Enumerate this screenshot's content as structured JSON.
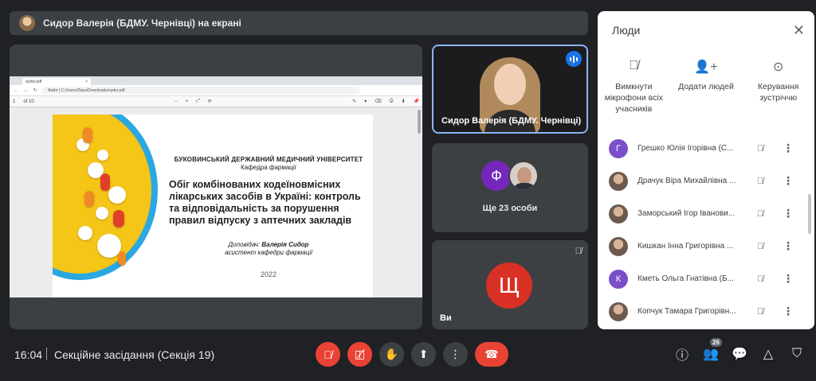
{
  "presenter_bar": {
    "title": "Сидор Валерія (БДМУ. Чернівці) на екрані"
  },
  "shared_screen": {
    "browser_tab_title": "sydor.pdf",
    "address": "Файл | C:/Users/Лера/Downloads/sydor.pdf",
    "pdf_page": "1",
    "pdf_page_total": "of 10",
    "pdf_zoom_minus": "−",
    "pdf_zoom_plus": "+",
    "slide": {
      "university": "БУКОВИНСЬКИЙ ДЕРЖАВНИЙ МЕДИЧНИЙ УНІВЕРСИТЕТ",
      "department": "Кафедра фармації",
      "title": "Обіг комбінованих кодеїновмісних лікарських засобів в Україні: контроль та відповідальність за порушення правил відпуску з аптечних закладів",
      "speaker_prefix": "Доповідач:",
      "speaker_name": "Валерія Сидор",
      "speaker_position": "асистент кафедри фармації",
      "year": "2022"
    }
  },
  "tiles": {
    "presenter_name": "Сидор Валерія (БДМУ. Чернівці)",
    "more_initial": "Ф",
    "more_label": "Ще 23 особи",
    "you_initial": "Щ",
    "you_label": "Ви"
  },
  "people_panel": {
    "title": "Люди",
    "actions": [
      {
        "label": "Вимкнути мікрофони всіх учасників",
        "icon": "mic-off-icon"
      },
      {
        "label": "Додати людей",
        "icon": "person-add-icon"
      },
      {
        "label": "Керування зустріччю",
        "icon": "toggle-icon"
      }
    ],
    "participants": [
      {
        "initial": "Г",
        "color": "#7b4fc9",
        "name": "Грешко Юлія Ігорівна (С...",
        "photo": false
      },
      {
        "initial": "",
        "color": "",
        "name": "Драчук Віра Михайлівна ...",
        "photo": true
      },
      {
        "initial": "",
        "color": "",
        "name": "Заморський Ігор Іванови...",
        "photo": true
      },
      {
        "initial": "",
        "color": "",
        "name": "Кишкан Інна Григорівна ...",
        "photo": true
      },
      {
        "initial": "К",
        "color": "#7b4fc9",
        "name": "Кметь Ольга Гнатівна (Б...",
        "photo": false
      },
      {
        "initial": "",
        "color": "",
        "name": "Копчук Тамара Григорівн...",
        "photo": true
      }
    ]
  },
  "bottom_bar": {
    "time": "16:04",
    "meeting_name": "Секційне засідання (Секція 19)",
    "participants_count": "26"
  },
  "colors": {
    "accent": "#1a73e8",
    "danger": "#ea4335",
    "surface": "#3c4043",
    "background": "#202124"
  }
}
